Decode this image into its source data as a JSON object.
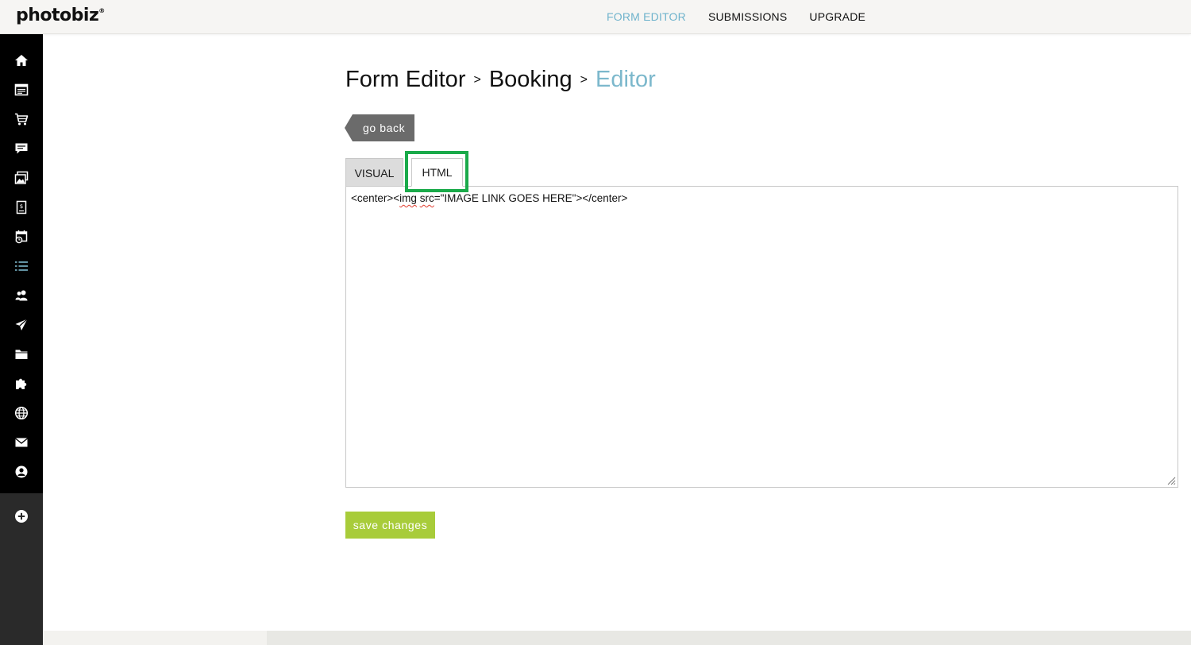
{
  "brand": {
    "logo_text": "photobiz",
    "logo_mark": "®"
  },
  "topnav": [
    {
      "label": "FORM EDITOR",
      "active": true
    },
    {
      "label": "SUBMISSIONS",
      "active": false
    },
    {
      "label": "UPGRADE",
      "active": false
    }
  ],
  "sidebar": {
    "items": [
      {
        "icon": "home-icon"
      },
      {
        "icon": "website-icon"
      },
      {
        "icon": "cart-icon"
      },
      {
        "icon": "chat-icon"
      },
      {
        "icon": "gallery-icon"
      },
      {
        "icon": "invoice-icon"
      },
      {
        "icon": "calendar-icon"
      },
      {
        "icon": "forms-list-icon",
        "active": true
      },
      {
        "icon": "contacts-icon"
      },
      {
        "icon": "send-icon"
      },
      {
        "icon": "folder-icon"
      },
      {
        "icon": "puzzle-icon"
      },
      {
        "icon": "globe-icon"
      },
      {
        "icon": "mail-icon"
      },
      {
        "icon": "account-icon"
      }
    ],
    "add_icon": "add-icon"
  },
  "breadcrumb": {
    "items": [
      "Form Editor",
      "Booking"
    ],
    "separator": ">",
    "current": "Editor"
  },
  "go_back_label": "go back",
  "tabs": [
    {
      "label": "VISUAL",
      "active": false
    },
    {
      "label": "HTML",
      "active": true
    }
  ],
  "editor": {
    "code_before": "<center><",
    "code_misspelled_1": "img",
    "code_space": " ",
    "code_misspelled_2": "src",
    "code_after": "=\"IMAGE LINK GOES HERE\"></center>"
  },
  "save_label": "save changes",
  "colors": {
    "accent_blue": "#7cb8cc",
    "save_green": "#a8cc3a",
    "highlight_green": "#1aaa4a",
    "sidebar_bg": "#000000"
  }
}
